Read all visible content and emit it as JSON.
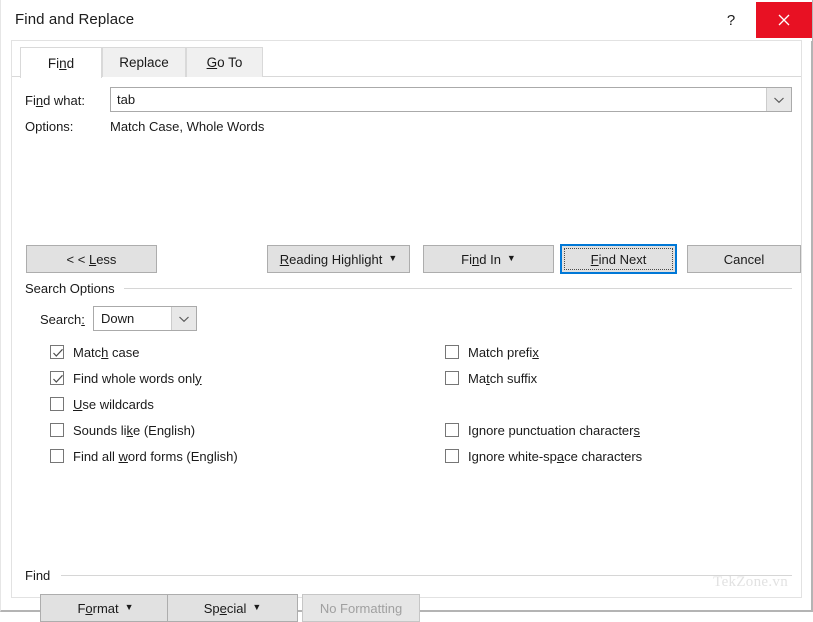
{
  "window": {
    "title": "Find and Replace",
    "help_label": "?",
    "close_label": "✕"
  },
  "tabs": [
    {
      "id": "find",
      "label_pre": "Fi",
      "label_accel": "n",
      "label_post": "d",
      "active": true
    },
    {
      "id": "replace",
      "label_pre": "",
      "label_accel": "",
      "label_post": "Replace",
      "active": false
    },
    {
      "id": "goto",
      "label_pre": "",
      "label_accel": "G",
      "label_post": "o To",
      "active": false
    }
  ],
  "find_what": {
    "label_pre": "Fi",
    "label_accel": "n",
    "label_post": "d what:",
    "value": "tab",
    "placeholder": "",
    "dropdown_icon": "chevron-down-icon"
  },
  "options": {
    "label": "Options:",
    "value": "Match Case, Whole Words"
  },
  "buttons": {
    "less": {
      "pre": "< < ",
      "accel": "L",
      "post": "ess",
      "caret": false,
      "disabled": false
    },
    "reading_highlight": {
      "pre": "",
      "accel": "R",
      "post": "eading Highlight",
      "caret": true,
      "disabled": false
    },
    "find_in": {
      "pre": "Fi",
      "accel": "n",
      "post": "d In",
      "caret": true,
      "disabled": false
    },
    "find_next": {
      "pre": "",
      "accel": "F",
      "post": "ind Next",
      "caret": false,
      "disabled": false,
      "default": true
    },
    "cancel": {
      "pre": "",
      "accel": "",
      "post": "Cancel",
      "caret": false,
      "disabled": false
    },
    "format": {
      "pre": "F",
      "accel": "o",
      "post": "rmat",
      "caret": true,
      "disabled": false
    },
    "special": {
      "pre": "Sp",
      "accel": "e",
      "post": "cial",
      "caret": true,
      "disabled": false
    },
    "no_formatting": {
      "pre": "",
      "accel": "",
      "post": "No Formatting",
      "caret": false,
      "disabled": true
    }
  },
  "search_options": {
    "group_title": "Search Options",
    "search_label_pre": "Search",
    "search_label_accel": ":",
    "search_label_post": "",
    "search_value": "Down",
    "search_dropdown_icon": "chevron-down-icon",
    "left_column": [
      {
        "pre": "Matc",
        "accel": "h",
        "post": " case",
        "checked": true
      },
      {
        "pre": "Find whole words onl",
        "accel": "y",
        "post": "",
        "checked": true
      },
      {
        "pre": "",
        "accel": "U",
        "post": "se wildcards",
        "checked": false
      },
      {
        "pre": "Sounds li",
        "accel": "k",
        "post": "e (English)",
        "checked": false
      },
      {
        "pre": "Find all ",
        "accel": "w",
        "post": "ord forms (English)",
        "checked": false
      }
    ],
    "right_column": [
      {
        "pre": "Match prefi",
        "accel": "x",
        "post": "",
        "checked": false,
        "gap_after": false
      },
      {
        "pre": "Ma",
        "accel": "t",
        "post": "ch suffix",
        "checked": false,
        "gap_after": true
      },
      {
        "pre": "Ignore punctuation character",
        "accel": "s",
        "post": "",
        "checked": false,
        "gap_after": false
      },
      {
        "pre": "Ignore white-sp",
        "accel": "a",
        "post": "ce characters",
        "checked": false,
        "gap_after": false
      }
    ]
  },
  "find_group": {
    "group_title": "Find"
  },
  "watermark": "TekZone.vn",
  "colors": {
    "close_red": "#e81123",
    "default_button_border": "#0078d7",
    "button_face": "#e1e1e1",
    "dialog_bg": "#ffffff"
  }
}
